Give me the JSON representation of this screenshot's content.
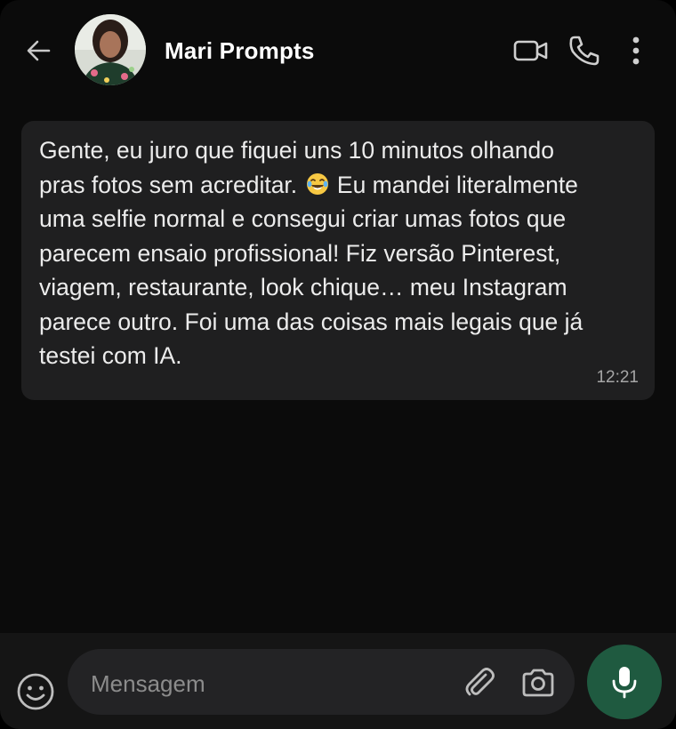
{
  "header": {
    "contact_name": "Mari Prompts",
    "back_icon": "arrow-left-icon",
    "avatar_icon": "profile-photo",
    "video_icon": "video-camera-icon",
    "call_icon": "phone-icon",
    "menu_icon": "more-vertical-icon"
  },
  "message": {
    "text": "Gente, eu juro que fiquei uns 10 minutos olhando\npras fotos sem acreditar. ",
    "emoji": "😂",
    "text_after": " Eu mandei literalmente\numa selfie normal e consegui criar umas fotos que\nparecem ensaio profissional! Fiz versão Pinterest,\nviagem, restaurante, look chique… meu Instagram\nparece outro. Foi uma das coisas mais legais que já\ntestei com IA.",
    "time": "12:21"
  },
  "composer": {
    "placeholder": "Mensagem",
    "emoji_icon": "smiley-icon",
    "attach_icon": "paperclip-icon",
    "camera_icon": "camera-icon",
    "mic_icon": "microphone-icon"
  },
  "colors": {
    "background": "#0b0b0b",
    "bubble": "#1f1f20",
    "footer": "#151515",
    "mic_button": "#1f5a40",
    "icon": "#cfcfcf"
  }
}
